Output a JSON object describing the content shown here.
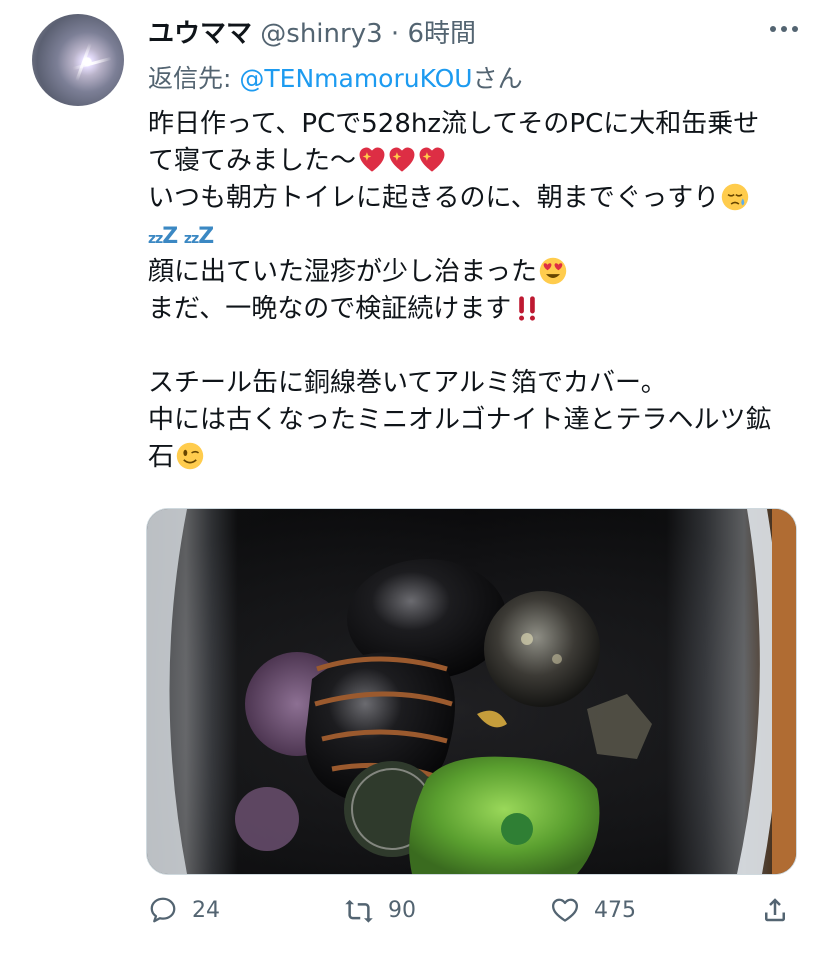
{
  "tweet": {
    "author_name": "ユウママ",
    "handle": "@shinry3",
    "separator": "·",
    "time": "6時間",
    "reply_prefix": "返信先: ",
    "reply_mention": "@TENmamoruKOU",
    "reply_suffix": "さん",
    "text_lines": [
      "昨日作って、PCで528hz流してそのPCに大和缶乗せ",
      "て寝てみました〜",
      "いつも朝方トイレに起きるのに、朝までぐっすり",
      "",
      "顔に出ていた湿疹が少し治まった",
      "まだ、一晩なので検証続けます",
      "",
      "スチール缶に銅線巻いてアルミ箔でカバー。",
      "中には古くなったミニオルゴナイト達とテラヘルツ鉱",
      "石"
    ],
    "emoji_icons": [
      "sparkling-heart-icon",
      "sleepy-face-icon",
      "zzz-icon",
      "heart-eyes-face-icon",
      "double-exclamation-icon",
      "winking-face-icon"
    ]
  },
  "actions": {
    "reply_count": "24",
    "retweet_count": "90",
    "like_count": "475"
  },
  "colors": {
    "text_primary": "#0f1419",
    "text_secondary": "#536471",
    "link": "#1d9bf0",
    "heart": "#dd2e44",
    "emoji_yellow": "#ffcc4d"
  }
}
